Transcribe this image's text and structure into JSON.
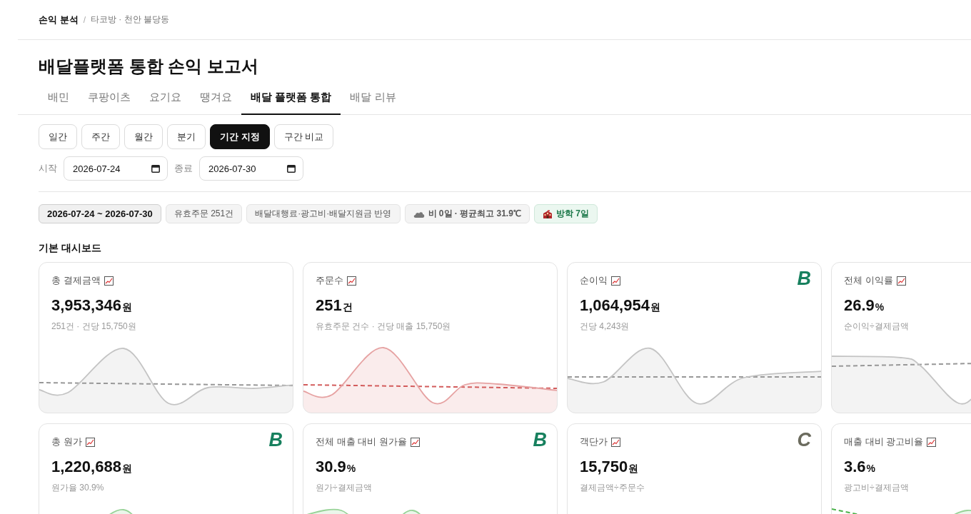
{
  "breadcrumb": {
    "section": "손익 분석",
    "separator": "/",
    "current": "타코방 · 천안 불당동"
  },
  "title": "배달플랫폼 통합 손익 보고서",
  "tabs": [
    {
      "label": "배민",
      "selected": false
    },
    {
      "label": "쿠팡이츠",
      "selected": false
    },
    {
      "label": "요기요",
      "selected": false
    },
    {
      "label": "땡겨요",
      "selected": false
    },
    {
      "label": "배달 플랫폼 통합",
      "selected": true
    },
    {
      "label": "배달 리뷰",
      "selected": false
    }
  ],
  "period_buttons": [
    {
      "label": "일간",
      "selected": false
    },
    {
      "label": "주간",
      "selected": false
    },
    {
      "label": "월간",
      "selected": false
    },
    {
      "label": "분기",
      "selected": false
    },
    {
      "label": "기간 지정",
      "selected": true
    },
    {
      "label": "구간 비교",
      "selected": false
    }
  ],
  "date_range": {
    "start": {
      "label": "시작",
      "value": "2026-07-24"
    },
    "end": {
      "label": "종료",
      "value": "2026-07-30"
    }
  },
  "chips": [
    {
      "kind": "period",
      "text": "2026-07-24 ~ 2026-07-30"
    },
    {
      "kind": "plain",
      "text": "유효주문 251건"
    },
    {
      "kind": "plain",
      "text": "배달대행료·광고비·배달지원금 반영"
    },
    {
      "kind": "weather",
      "text": "비 0일 · 평균최고 31.9℃"
    },
    {
      "kind": "event",
      "text": "방학 7일"
    }
  ],
  "section_title": "기본 대시보드",
  "cards": [
    {
      "title": "총 결제금액",
      "value": "3,953,346",
      "unit": "원",
      "note": "251건 · 건당 15,750원",
      "color": "#c4c4c4"
    },
    {
      "title": "주문수",
      "value": "251",
      "unit": "건",
      "note": "유효주문 건수 · 건당 매출 15,750원",
      "color": "#e6a2a2"
    },
    {
      "title": "순이익",
      "value": "1,064,954",
      "unit": "원",
      "note": "건당 4,243원",
      "color": "#c4c4c4",
      "grade": {
        "text": "B",
        "color": "#17805e"
      }
    },
    {
      "title": "전체 이익률",
      "value": "26.9",
      "unit": "%",
      "note": "순이익÷결제금액",
      "color": "#c4c4c4"
    },
    {
      "title": "총 원가",
      "value": "1,220,688",
      "unit": "원",
      "note": "원가율 30.9%",
      "color": "#98d398",
      "grade": {
        "text": "B",
        "color": "#17805e"
      }
    },
    {
      "title": "전체 매출 대비 원가율",
      "value": "30.9",
      "unit": "%",
      "note": "원가÷결제금액",
      "color": "#98d398",
      "grade": {
        "text": "B",
        "color": "#17805e"
      }
    },
    {
      "title": "객단가",
      "value": "15,750",
      "unit": "원",
      "note": "결제금액÷주문수",
      "grade": {
        "text": "C",
        "color": "#6b6b5e"
      }
    },
    {
      "title": "매출 대비 광고비율",
      "value": "3.6",
      "unit": "%",
      "note": "광고비÷결제금액",
      "color": "#98d398"
    }
  ]
}
